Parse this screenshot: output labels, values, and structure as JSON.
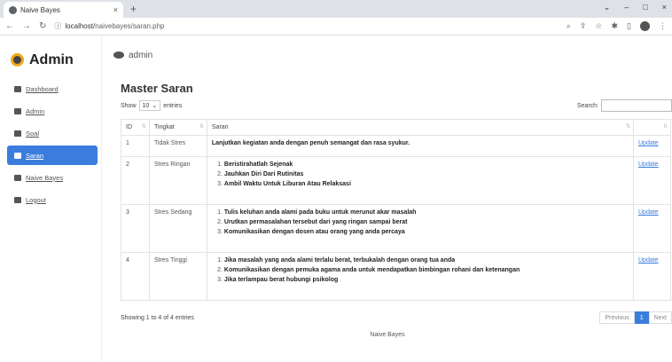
{
  "browser": {
    "tab_title": "Naive Bayes",
    "tab_close": "×",
    "new_tab": "+",
    "url_prefix": "localhost/",
    "url_rest": "naivebayes/saran.php",
    "win_min": "–",
    "win_max": "□",
    "win_close": "×"
  },
  "sidebar": {
    "brand": "Admin",
    "items": [
      {
        "label": "Dashboard",
        "icon": "dashboard-icon"
      },
      {
        "label": "Admin",
        "icon": "user-icon"
      },
      {
        "label": "Soal",
        "icon": "book-icon"
      },
      {
        "label": "Saran",
        "icon": "comment-icon"
      },
      {
        "label": "Naive Bayes",
        "icon": "folder-icon"
      },
      {
        "label": "Logout",
        "icon": "logout-icon"
      }
    ],
    "active": "Saran"
  },
  "topbar": {
    "user": "admin"
  },
  "main": {
    "title": "Master Saran",
    "show_label": "Show",
    "show_value": "10",
    "entries_label": "entries",
    "search_label": "Search:",
    "columns": [
      "ID",
      "Tingkat",
      "Saran",
      ""
    ],
    "rows": [
      {
        "id": "1",
        "tingkat": "Tidak Stres",
        "saran": [
          "Lanjutkan kegiatan anda dengan penuh semangat dan rasa syukur."
        ],
        "list": false,
        "action": "Update"
      },
      {
        "id": "2",
        "tingkat": "Stres Ringan",
        "saran": [
          "Beristirahatlah Sejenak",
          "Jauhkan Diri Dari Rutinitas",
          "Ambil Waktu Untuk Liburan Atau Relaksasi"
        ],
        "list": true,
        "action": "Update"
      },
      {
        "id": "3",
        "tingkat": "Stres Sedang",
        "saran": [
          "Tulis keluhan anda alami pada buku untuk merunut akar masalah",
          "Urutkan permasalahan tersebut dari yang ringan sampai berat",
          "Komunikasikan dengan dosen atau orang yang anda percaya"
        ],
        "list": true,
        "action": "Update"
      },
      {
        "id": "4",
        "tingkat": "Stres Tinggi",
        "saran": [
          "Jika masalah yang anda alami terlalu berat, terbukalah dengan orang tua anda",
          "Komunikasikan dengan pemuka agama anda untuk mendapatkan bimbingan rohani dan ketenangan",
          "Jika terlampau berat hubungi psikolog"
        ],
        "list": true,
        "action": "Update"
      }
    ],
    "info": "Showing 1 to 4 of 4 entries",
    "pager": {
      "prev": "Previous",
      "page": "1",
      "next": "Next"
    }
  },
  "footer": "Naive Bayes",
  "colors": {
    "accent": "#3b7ddd",
    "brand_ring": "#f0a81c"
  }
}
